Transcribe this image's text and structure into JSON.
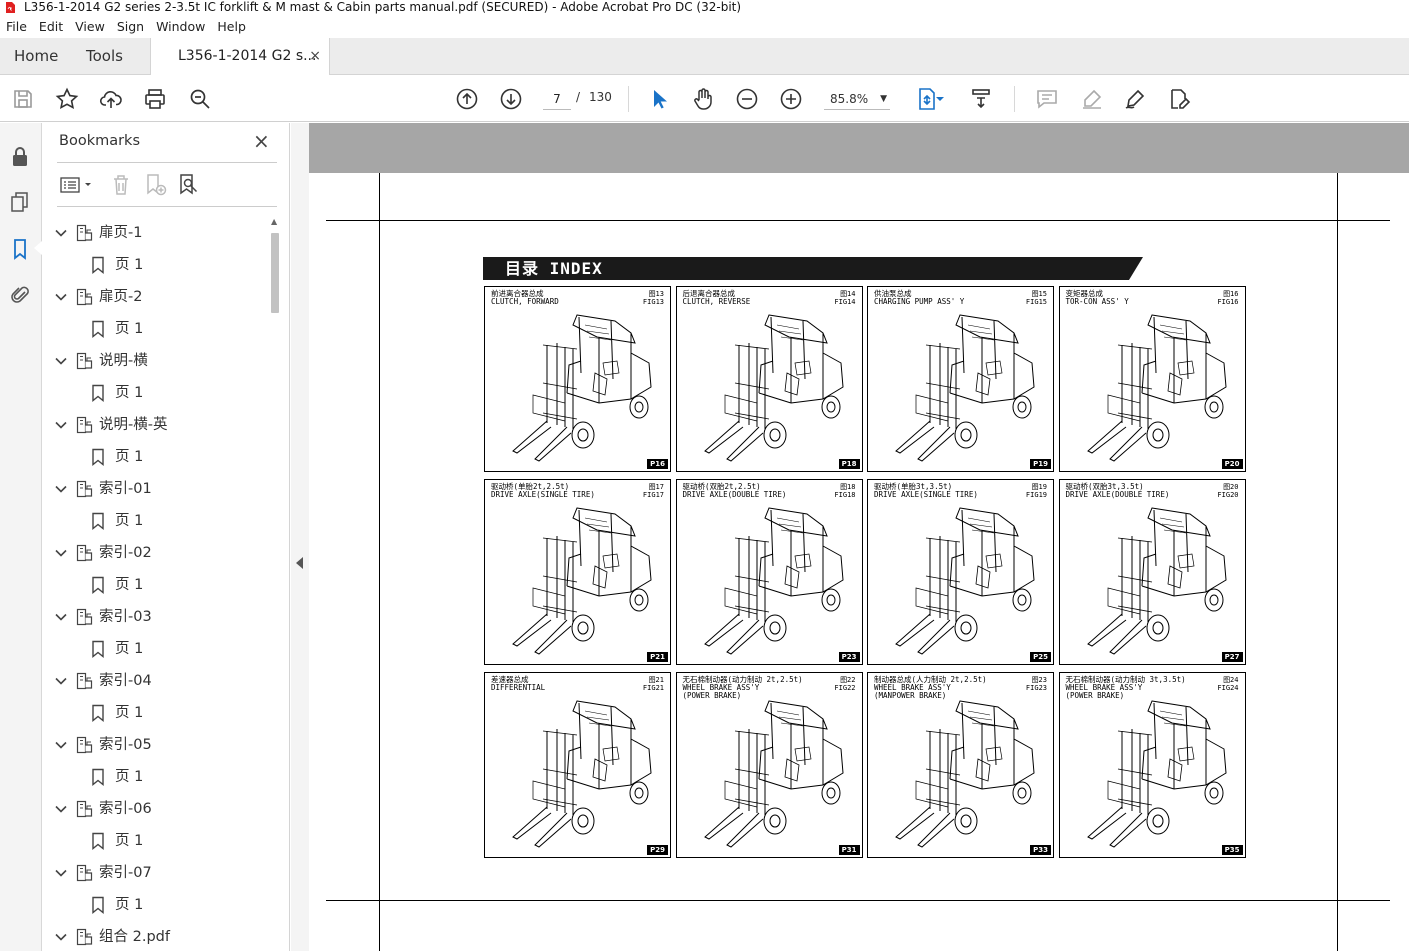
{
  "window": {
    "title": "L356-1-2014 G2 series 2-3.5t IC forklift & M mast & Cabin parts manual.pdf (SECURED) - Adobe Acrobat Pro DC (32-bit)"
  },
  "menu": [
    "File",
    "Edit",
    "View",
    "Sign",
    "Window",
    "Help"
  ],
  "tabs": {
    "home": "Home",
    "tools": "Tools",
    "document": "L356-1-2014 G2 s...",
    "close": "×"
  },
  "toolbar": {
    "page_current": "7",
    "page_sep": "/",
    "page_total": "130",
    "zoom": "85.8%"
  },
  "bookmarks": {
    "title": "Bookmarks",
    "close": "×",
    "items": [
      {
        "label": "扉页-1",
        "level": 0
      },
      {
        "label": "页 1",
        "level": 1
      },
      {
        "label": "扉页-2",
        "level": 0
      },
      {
        "label": "页 1",
        "level": 1
      },
      {
        "label": "说明-横",
        "level": 0
      },
      {
        "label": "页 1",
        "level": 1
      },
      {
        "label": "说明-横-英",
        "level": 0
      },
      {
        "label": "页 1",
        "level": 1
      },
      {
        "label": "索引-01",
        "level": 0
      },
      {
        "label": "页 1",
        "level": 1
      },
      {
        "label": "索引-02",
        "level": 0
      },
      {
        "label": "页 1",
        "level": 1
      },
      {
        "label": "索引-03",
        "level": 0
      },
      {
        "label": "页 1",
        "level": 1
      },
      {
        "label": "索引-04",
        "level": 0
      },
      {
        "label": "页 1",
        "level": 1
      },
      {
        "label": "索引-05",
        "level": 0
      },
      {
        "label": "页 1",
        "level": 1
      },
      {
        "label": "索引-06",
        "level": 0
      },
      {
        "label": "页 1",
        "level": 1
      },
      {
        "label": "索引-07",
        "level": 0
      },
      {
        "label": "页 1",
        "level": 1
      },
      {
        "label": "组合 2.pdf",
        "level": 0
      }
    ]
  },
  "document": {
    "index_heading": "目录  INDEX",
    "cells": [
      {
        "title": "前进离合器总成\nCLUTCH, FORWARD",
        "fig": "图13\nFIG13",
        "page": "P16"
      },
      {
        "title": "后退离合器总成\nCLUTCH, REVERSE",
        "fig": "图14\nFIG14",
        "page": "P18"
      },
      {
        "title": "供油泵总成\nCHARGING PUMP ASS' Y",
        "fig": "图15\nFIG15",
        "page": "P19"
      },
      {
        "title": "变矩器总成\nTOR-CON ASS' Y",
        "fig": "图16\nFIG16",
        "page": "P20"
      },
      {
        "title": "驱动桥(单胎2t,2.5t)\nDRIVE AXLE(SINGLE TIRE)",
        "fig": "图17\nFIG17",
        "page": "P21"
      },
      {
        "title": "驱动桥(双胎2t,2.5t)\nDRIVE AXLE(DOUBLE TIRE)",
        "fig": "图18\nFIG18",
        "page": "P23"
      },
      {
        "title": "驱动桥(单胎3t,3.5t)\nDRIVE AXLE(SINGLE TIRE)",
        "fig": "图19\nFIG19",
        "page": "P25"
      },
      {
        "title": "驱动桥(双胎3t,3.5t)\nDRIVE AXLE(DOUBLE TIRE)",
        "fig": "图20\nFIG20",
        "page": "P27"
      },
      {
        "title": "差速器总成\nDIFFERENTIAL",
        "fig": "图21\nFIG21",
        "page": "P29"
      },
      {
        "title": "无石棉制动器(动力制动 2t,2.5t)\nWHEEL BRAKE ASS'Y\n(POWER BRAKE)",
        "fig": "图22\nFIG22",
        "page": "P31"
      },
      {
        "title": "制动器总成(人力制动 2t,2.5t)\nWHEEL BRAKE ASS'Y\n(MANPOWER BRAKE)",
        "fig": "图23\nFIG23",
        "page": "P33"
      },
      {
        "title": "无石棉制动器(动力制动 3t,3.5t)\nWHEEL BRAKE ASS'Y\n(POWER BRAKE)",
        "fig": "图24\nFIG24",
        "page": "P35"
      }
    ]
  },
  "colors": {
    "accent": "#1a73c8",
    "doc_bg": "#a6a6a6",
    "pdf_red": "#e02020"
  }
}
